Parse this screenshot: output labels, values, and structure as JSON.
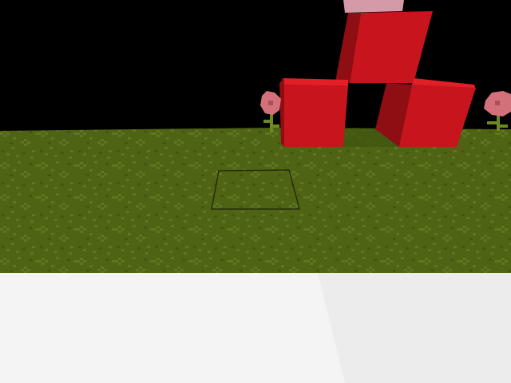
{
  "scene": {
    "sky_color": "#000000",
    "ground_color": "#4e6313",
    "ground_speckle_color": "#5e7522",
    "ground_dark_speckle_color": "#445711",
    "block_face_front": "#c8141c",
    "block_face_side": "#8e0e14",
    "block_face_top": "#e21e26",
    "block_above_color": "#d49aa8",
    "flower_petal_color": "#d4707a",
    "flower_center_color": "#b04e58",
    "flower_stem_color": "#6d8a22",
    "selection_outline_color": "#1c2408",
    "held_item_color": "#f4f4f4",
    "held_item_shade_color": "#ececec"
  }
}
